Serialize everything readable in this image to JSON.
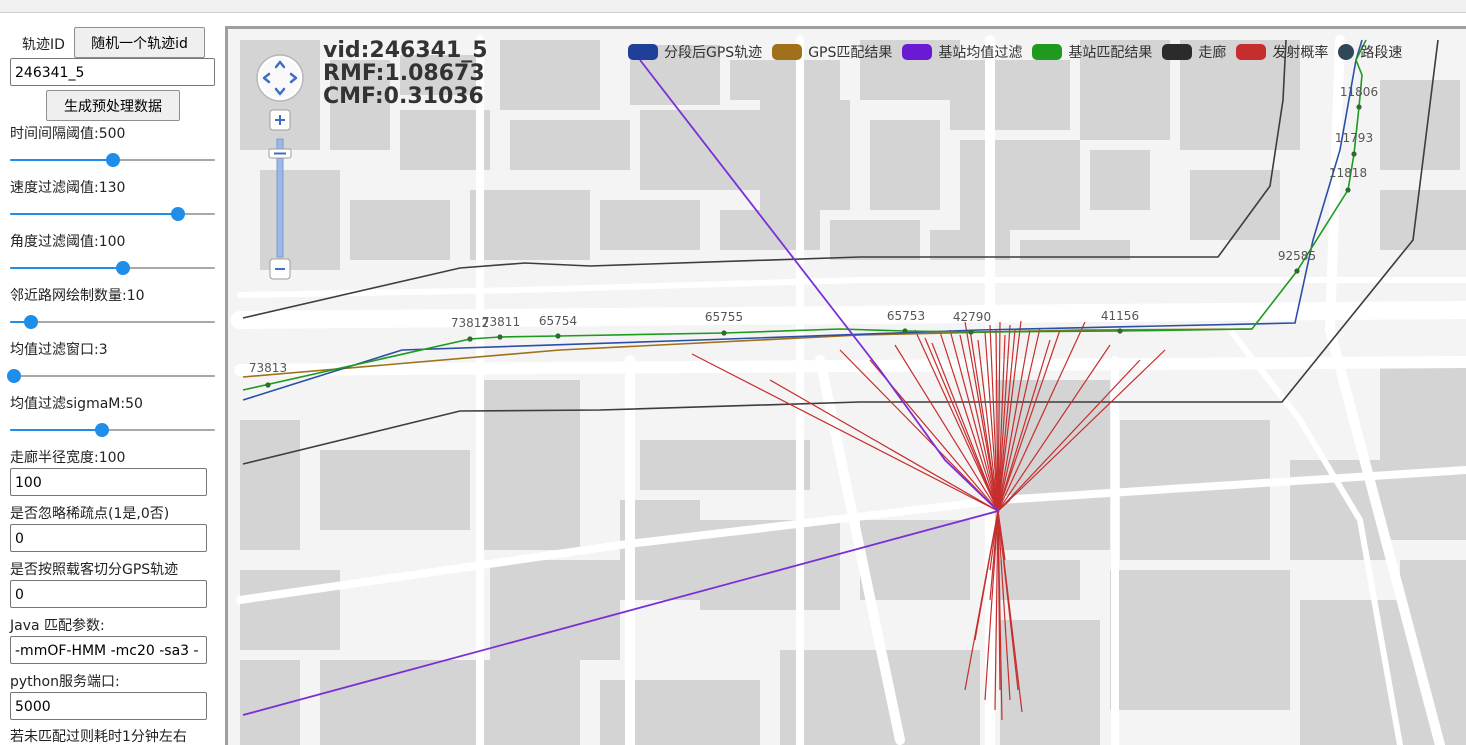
{
  "sidebar": {
    "track_id_label": "轨迹ID",
    "random_button": "随机一个轨迹id",
    "track_id_value": "246341_5",
    "preprocess_button": "生成预处理数据",
    "sliders": [
      {
        "label": "时间间隔阈值:500",
        "fraction": 0.5
      },
      {
        "label": "速度过滤阈值:130",
        "fraction": 0.82
      },
      {
        "label": "角度过滤阈值:100",
        "fraction": 0.55
      },
      {
        "label": "邻近路网绘制数量:10",
        "fraction": 0.1
      },
      {
        "label": "均值过滤窗口:3",
        "fraction": 0.02
      },
      {
        "label": "均值过滤sigmaM:50",
        "fraction": 0.45
      }
    ],
    "fields": [
      {
        "label": "走廊半径宽度:100",
        "value": "100"
      },
      {
        "label": "是否忽略稀疏点(1是,0否)",
        "value": "0"
      },
      {
        "label": "是否按照载客切分GPS轨迹",
        "value": "0"
      },
      {
        "label": "Java 匹配参数:",
        "value": "-mmOF-HMM -mc20 -sa3 -"
      },
      {
        "label": "python服务端口:",
        "value": "5000"
      }
    ],
    "footer_note": "若未匹配过则耗时1分钟左右"
  },
  "map": {
    "info": {
      "vid": "vid:246341_5",
      "rmf": "RMF:1.08673",
      "cmf": "CMF:0.31036"
    },
    "legend": [
      {
        "label": "分段后GPS轨迹",
        "color": "#1f3f99",
        "shape": "rect"
      },
      {
        "label": "GPS匹配结果",
        "color": "#a0701a",
        "shape": "rect"
      },
      {
        "label": "基站均值过滤",
        "color": "#6a1bd1",
        "shape": "rect"
      },
      {
        "label": "基站匹配结果",
        "color": "#1e9a1e",
        "shape": "rect"
      },
      {
        "label": "走廊",
        "color": "#2b2b2b",
        "shape": "rect"
      },
      {
        "label": "发射概率",
        "color": "#c62e2e",
        "shape": "rect"
      },
      {
        "label": "路段速",
        "color": "#2f4858",
        "shape": "circle"
      }
    ],
    "station_labels": [
      "73813",
      "73812",
      "73811",
      "65754",
      "65755",
      "65753",
      "42790",
      "41156",
      "92585",
      "11818",
      "11793",
      "11806"
    ],
    "icons": {
      "pan": "pan-arrows-icon",
      "zoom_in": "plus-icon",
      "zoom_out": "minus-icon"
    }
  }
}
